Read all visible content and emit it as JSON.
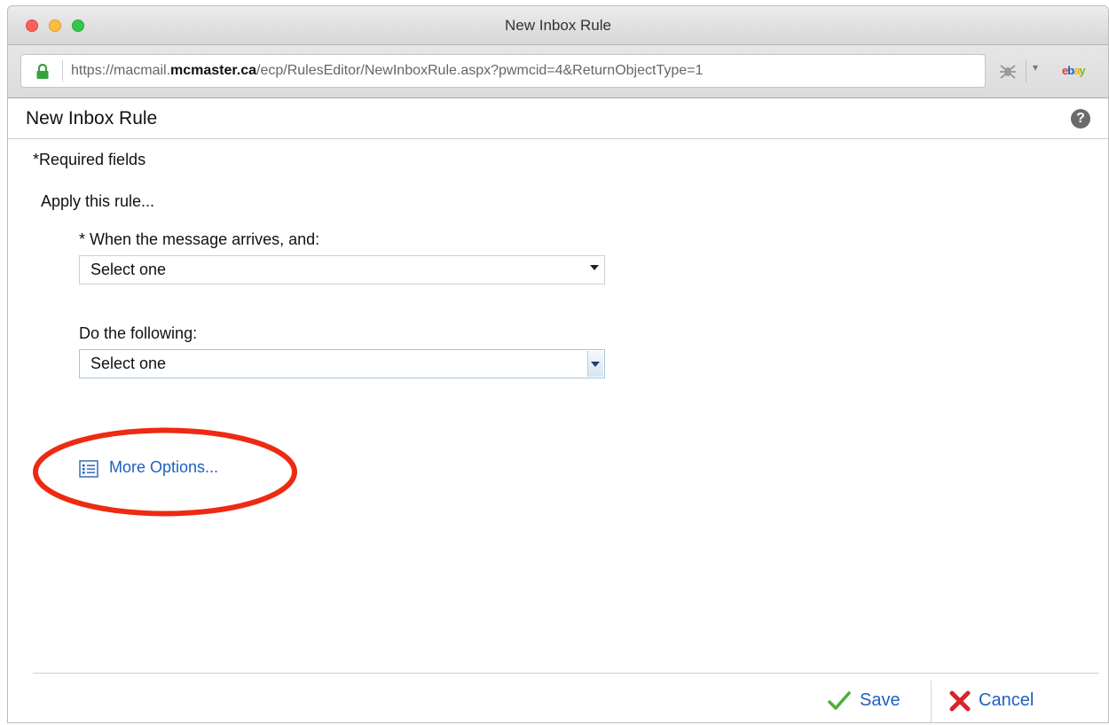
{
  "window": {
    "title": "New Inbox Rule"
  },
  "addressbar": {
    "url_prefix": "https://macmail.",
    "url_domain": "mcmaster.ca",
    "url_path": "/ecp/RulesEditor/NewInboxRule.aspx?pwmcid=4&ReturnObjectType=1",
    "icons": [
      "lock-icon",
      "bug-icon",
      "dropdown-icon",
      "ebay-icon"
    ],
    "ebay_letters": [
      "e",
      "b",
      "a",
      "y"
    ],
    "ebay_colors": [
      "#e53238",
      "#0064d2",
      "#f5af02",
      "#86b817"
    ]
  },
  "page": {
    "title": "New Inbox Rule",
    "help": "?",
    "required_note": "*Required fields",
    "apply_label": "Apply this rule..."
  },
  "form": {
    "when_label": "* When the message arrives, and:",
    "when_value": "Select one",
    "do_label": "Do the following:",
    "do_value": "Select one",
    "more_options": "More Options..."
  },
  "footer": {
    "save_label": "Save",
    "cancel_label": "Cancel"
  },
  "colors": {
    "link": "#1e5fc2",
    "annotation_ring": "#ee2a12",
    "save_check": "#4caf35",
    "cancel_x": "#d8242a"
  }
}
